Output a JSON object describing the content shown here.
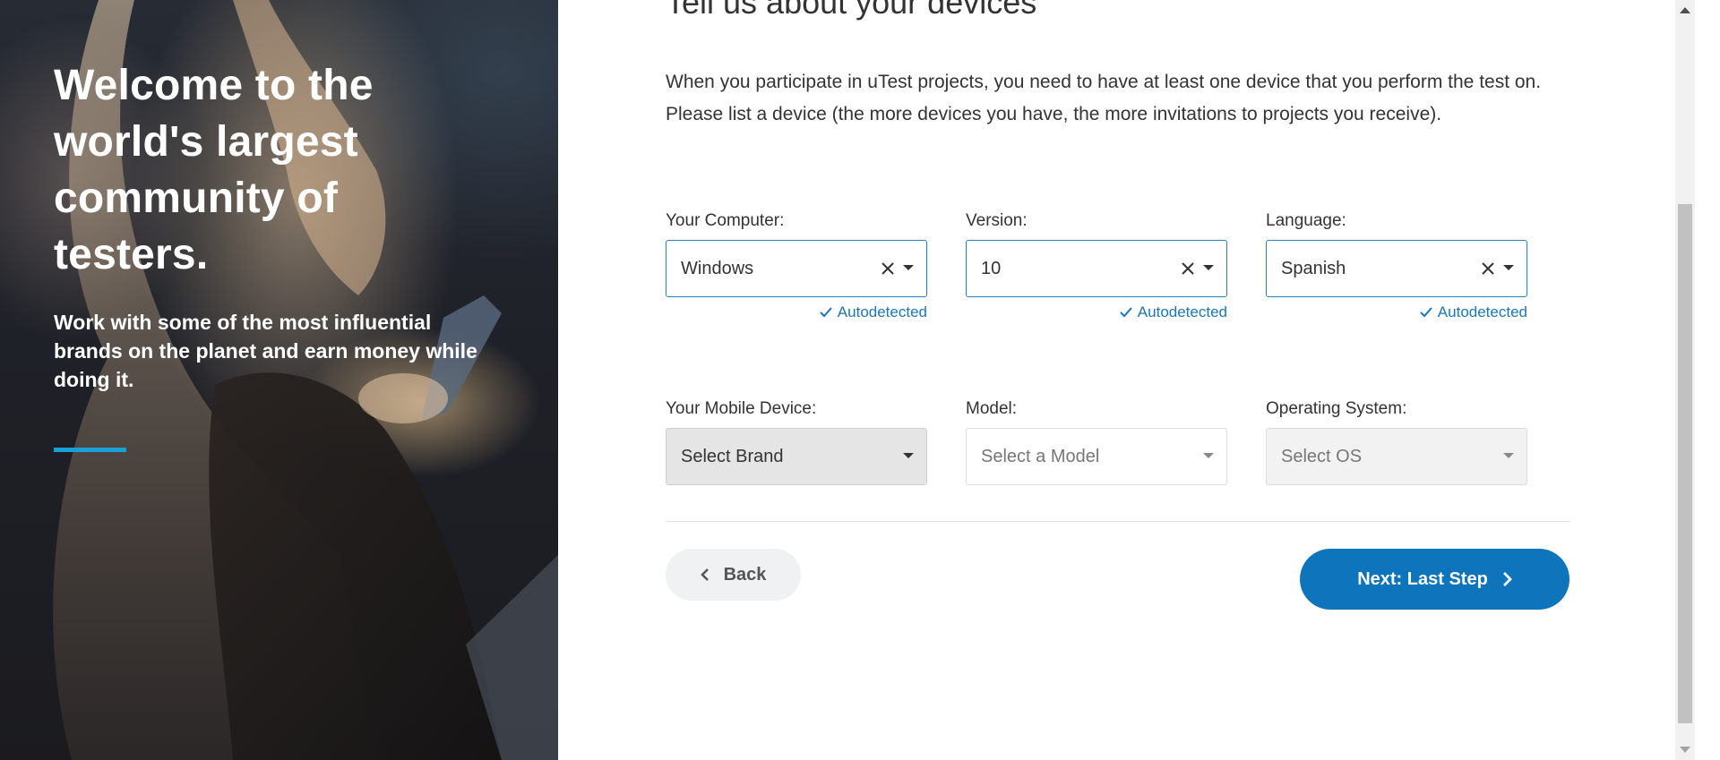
{
  "hero": {
    "title": "Welcome to the world's largest community of testers.",
    "subtitle": "Work with some of the most influential brands on the planet and earn money while doing it.",
    "accent_color": "#1aa0d8"
  },
  "form": {
    "heading": "Tell us about your devices",
    "intro": "When you participate in uTest projects, you need to have at least one device that you perform the test on. Please list a device (the more devices you have, the more invitations to projects you receive).",
    "computer": {
      "label": "Your Computer:",
      "value": "Windows",
      "autodetected": "Autodetected"
    },
    "version": {
      "label": "Version:",
      "value": "10",
      "autodetected": "Autodetected"
    },
    "language": {
      "label": "Language:",
      "value": "Spanish",
      "autodetected": "Autodetected"
    },
    "mobile": {
      "label": "Your Mobile Device:",
      "placeholder": "Select Brand"
    },
    "model": {
      "label": "Model:",
      "placeholder": "Select a Model"
    },
    "os": {
      "label": "Operating System:",
      "placeholder": "Select OS"
    },
    "back_label": "Back",
    "next_label": "Next: Last Step",
    "primary_color": "#0e75bc"
  },
  "icons": {
    "clear": "close-icon",
    "caret": "caret-down-icon",
    "check": "check-icon",
    "back": "chevron-left-icon",
    "next": "chevron-right-icon"
  }
}
